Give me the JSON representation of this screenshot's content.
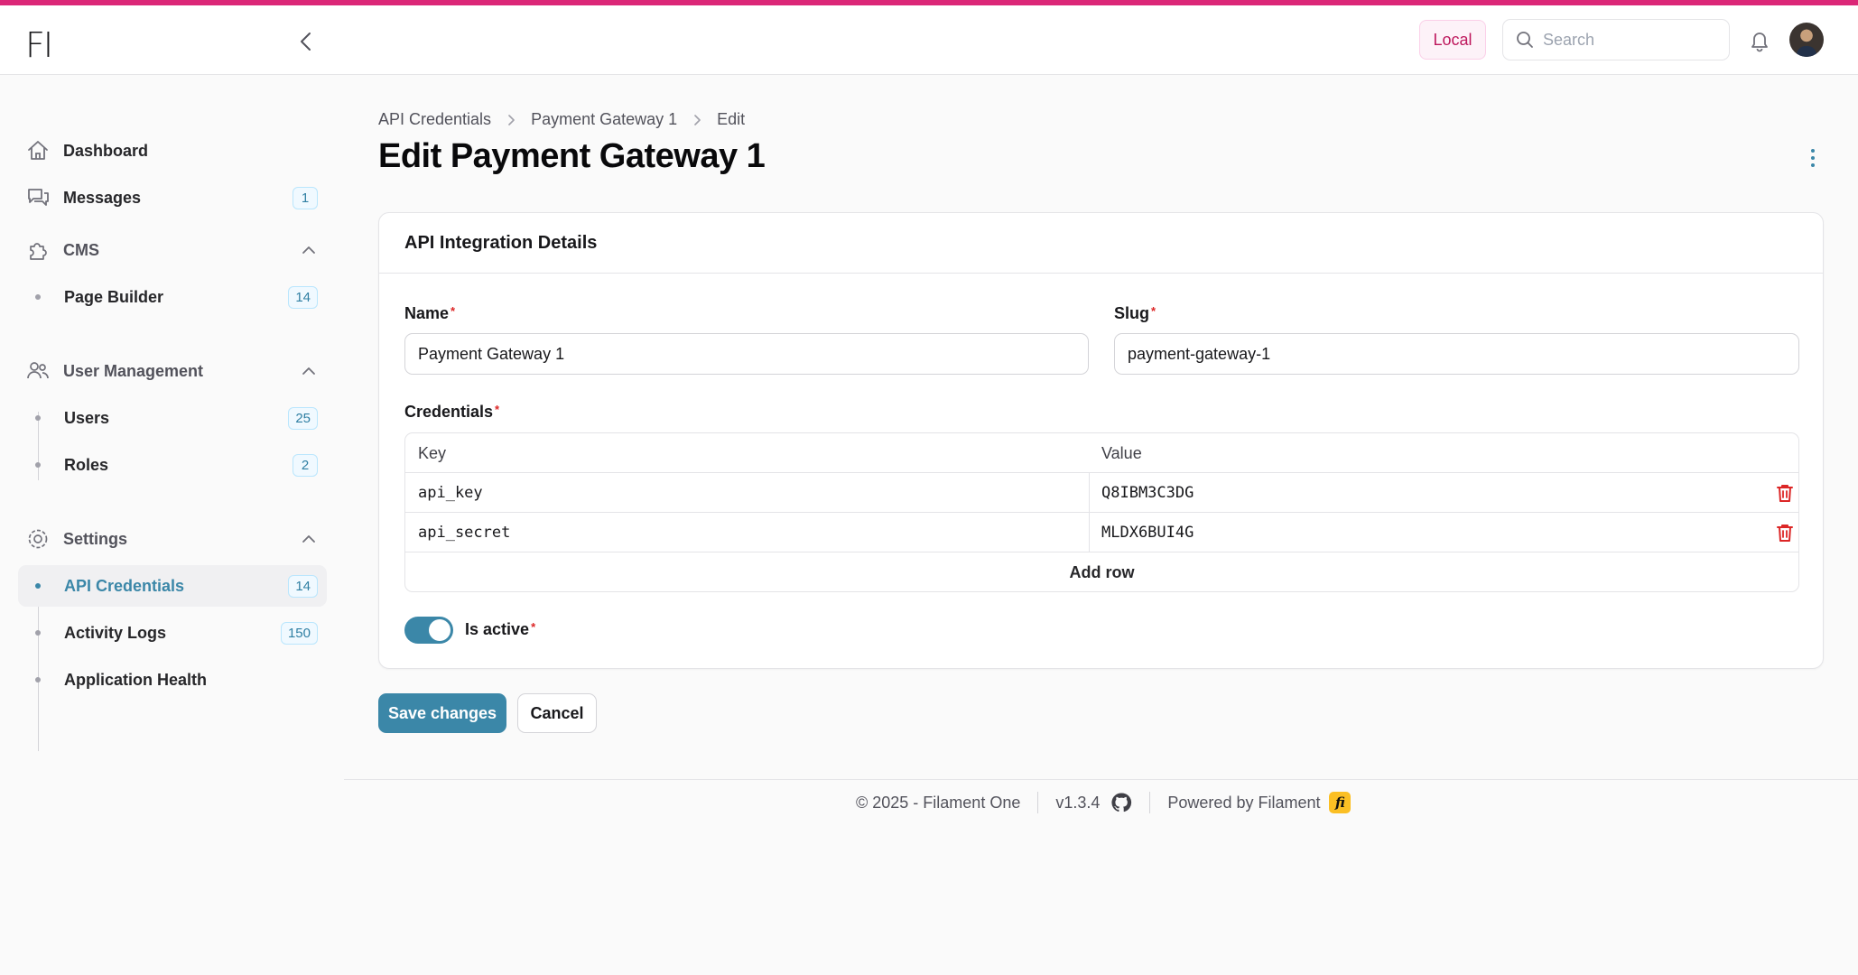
{
  "app": {
    "logo_text": "FI",
    "env_badge": "Local",
    "search_placeholder": "Search",
    "accent_color": "#3b87a8",
    "brand_stripe_color": "#db2777"
  },
  "sidebar": {
    "dashboard": "Dashboard",
    "messages": {
      "label": "Messages",
      "badge": "1"
    },
    "cms": {
      "label": "CMS",
      "items": [
        {
          "label": "Page Builder",
          "badge": "14"
        }
      ]
    },
    "user_management": {
      "label": "User Management",
      "items": [
        {
          "label": "Users",
          "badge": "25"
        },
        {
          "label": "Roles",
          "badge": "2"
        }
      ]
    },
    "settings": {
      "label": "Settings",
      "items": [
        {
          "label": "API Credentials",
          "badge": "14",
          "active": true
        },
        {
          "label": "Activity Logs",
          "badge": "150"
        },
        {
          "label": "Application Health"
        }
      ]
    }
  },
  "breadcrumb": [
    "API Credentials",
    "Payment Gateway 1",
    "Edit"
  ],
  "page_title": "Edit Payment Gateway 1",
  "form": {
    "section_title": "API Integration Details",
    "name_label": "Name",
    "name_value": "Payment Gateway 1",
    "slug_label": "Slug",
    "slug_value": "payment-gateway-1",
    "credentials_label": "Credentials",
    "credentials": {
      "key_header": "Key",
      "value_header": "Value",
      "rows": [
        {
          "key": "api_key",
          "value": "Q8IBM3C3DG"
        },
        {
          "key": "api_secret",
          "value": "MLDX6BUI4G"
        }
      ],
      "add_row_label": "Add row"
    },
    "is_active_label": "Is active",
    "is_active": true,
    "required_mark": "*"
  },
  "actions": {
    "save": "Save changes",
    "cancel": "Cancel"
  },
  "footer": {
    "copyright": "© 2025 - Filament One",
    "version": "v1.3.4",
    "powered_by": "Powered by Filament",
    "fi_logo": "fi"
  }
}
